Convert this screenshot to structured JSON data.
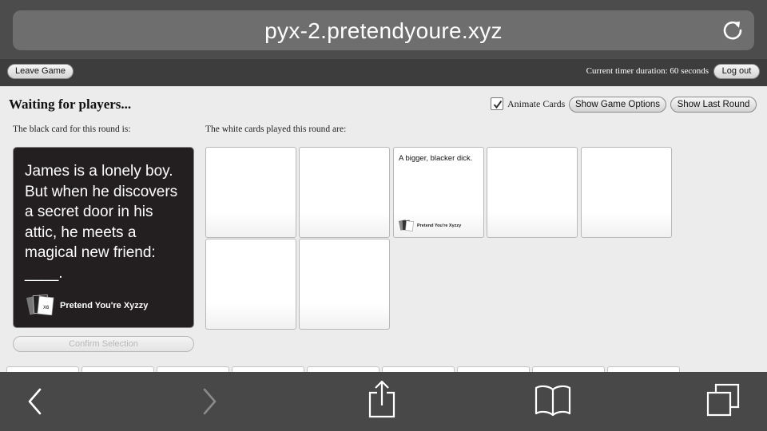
{
  "browser": {
    "url": "pyx-2.pretendyoure.xyz",
    "reload_icon": "reload-icon",
    "toolbar_icons": [
      "back-icon",
      "forward-icon",
      "share-icon",
      "bookmarks-icon",
      "tabs-icon"
    ]
  },
  "game_header": {
    "leave_label": "Leave Game",
    "timer_text": "Current timer duration: 60 seconds",
    "logout_label": "Log out"
  },
  "game": {
    "status": "Waiting for players...",
    "animate_label": "Animate Cards",
    "animate_checked": true,
    "show_options_label": "Show Game Options",
    "show_last_round_label": "Show Last Round",
    "black_card_label": "The black card for this round is:",
    "white_cards_label": "The white cards played this round are:",
    "confirm_label": "Confirm Selection"
  },
  "black_card": {
    "text": "James is a lonely boy. But when he discovers a secret door in his attic, he meets a magical new friend: ____.",
    "brand": "Pretend You're Xyzzy",
    "logo_text": "X6"
  },
  "white_cards": [
    {
      "text": "",
      "brand": ""
    },
    {
      "text": "",
      "brand": ""
    },
    {
      "text": "A bigger, blacker dick.",
      "brand": "Pretend You're Xyzzy"
    },
    {
      "text": "",
      "brand": ""
    },
    {
      "text": "",
      "brand": ""
    },
    {
      "text": "",
      "brand": ""
    },
    {
      "text": "",
      "brand": ""
    }
  ],
  "hand_card_count": 9,
  "colors": {
    "browser_chrome": "#4c4c4c",
    "header_strip": "#3d3d3d",
    "page_bg": "#ececec",
    "black_card": "#231f20"
  }
}
